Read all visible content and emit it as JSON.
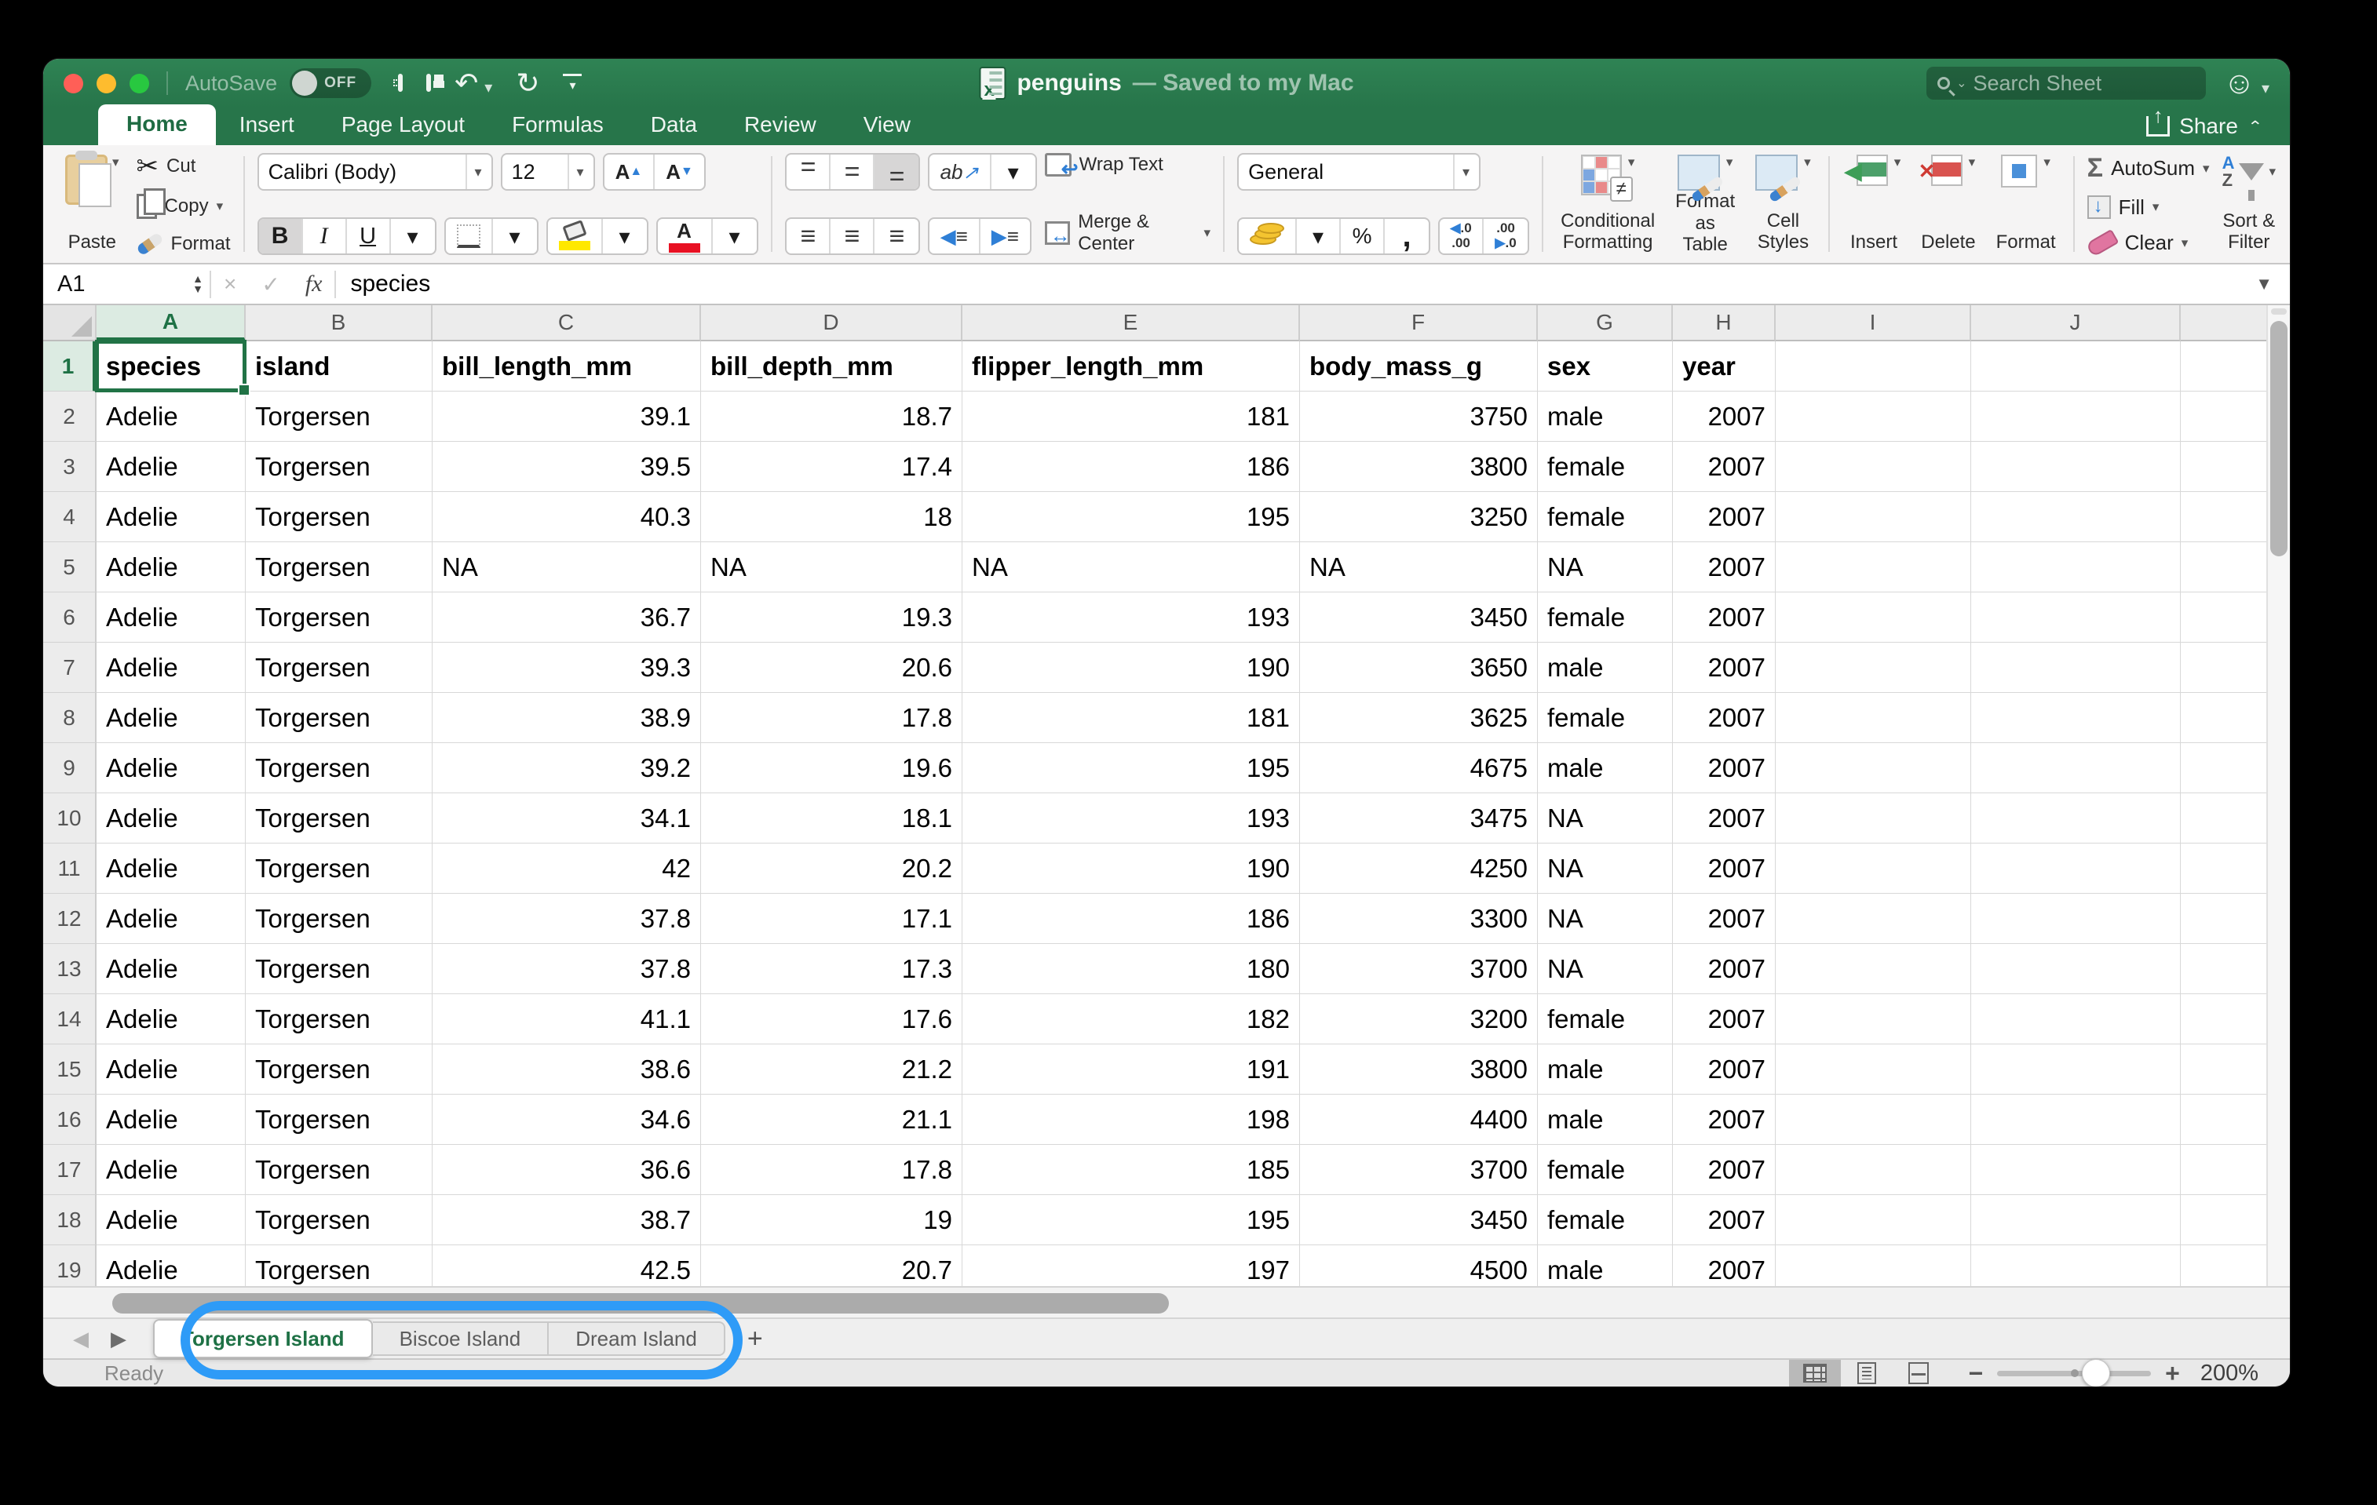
{
  "titlebar": {
    "autosave_label": "AutoSave",
    "autosave_state": "OFF",
    "file_name": "penguins",
    "file_status": "— Saved to my Mac",
    "search_placeholder": "Search Sheet"
  },
  "ribbon_tabs": [
    {
      "label": "Home",
      "active": true
    },
    {
      "label": "Insert",
      "active": false
    },
    {
      "label": "Page Layout",
      "active": false
    },
    {
      "label": "Formulas",
      "active": false
    },
    {
      "label": "Data",
      "active": false
    },
    {
      "label": "Review",
      "active": false
    },
    {
      "label": "View",
      "active": false
    }
  ],
  "share_label": "Share",
  "ribbon": {
    "clipboard": {
      "paste": "Paste",
      "cut": "Cut",
      "copy": "Copy",
      "format": "Format",
      "scissors_glyph": "✂"
    },
    "font": {
      "name": "Calibri (Body)",
      "size": "12",
      "bold": "B",
      "italic": "I",
      "underline": "U",
      "grow": "A",
      "shrink": "A",
      "color_letter": "A"
    },
    "alignment": {
      "lines_glyph": "≡",
      "orientation": "ab"
    },
    "wrap": {
      "wrap_text": "Wrap Text",
      "merge_center": "Merge & Center"
    },
    "number": {
      "format": "General",
      "percent": "%",
      "comma": ",",
      "inc_top": ".0",
      "inc_bot": ".00",
      "dec_top": ".00",
      "dec_bot": ".0"
    },
    "styles": {
      "cond_line1": "Conditional",
      "cond_line2": "Formatting",
      "neq": "≠",
      "fat_line1": "Format",
      "fat_line2": "as Table",
      "cs_line1": "Cell",
      "cs_line2": "Styles"
    },
    "cells": {
      "insert": "Insert",
      "delete": "Delete",
      "format": "Format",
      "ins_arrow": "◀",
      "del_x": "✕"
    },
    "editing": {
      "autosum_glyph": "Σ",
      "autosum": "AutoSum",
      "fill": "Fill",
      "clear": "Clear",
      "sort_line1": "Sort &",
      "sort_line2": "Filter",
      "az_a": "A",
      "az_z": "Z"
    }
  },
  "formula_bar": {
    "name_box": "A1",
    "cancel": "×",
    "enter": "✓",
    "fx": "fx",
    "value": "species"
  },
  "grid": {
    "column_letters": [
      "A",
      "B",
      "C",
      "D",
      "E",
      "F",
      "G",
      "H",
      "I",
      "J"
    ],
    "selected": {
      "cell": "A1",
      "column": "A",
      "row": 1
    },
    "header_row": [
      "species",
      "island",
      "bill_length_mm",
      "bill_depth_mm",
      "flipper_length_mm",
      "body_mass_g",
      "sex",
      "year"
    ],
    "rows": [
      [
        "Adelie",
        "Torgersen",
        "39.1",
        "18.7",
        "181",
        "3750",
        "male",
        "2007"
      ],
      [
        "Adelie",
        "Torgersen",
        "39.5",
        "17.4",
        "186",
        "3800",
        "female",
        "2007"
      ],
      [
        "Adelie",
        "Torgersen",
        "40.3",
        "18",
        "195",
        "3250",
        "female",
        "2007"
      ],
      [
        "Adelie",
        "Torgersen",
        "NA",
        "NA",
        "NA",
        "NA",
        "NA",
        "2007"
      ],
      [
        "Adelie",
        "Torgersen",
        "36.7",
        "19.3",
        "193",
        "3450",
        "female",
        "2007"
      ],
      [
        "Adelie",
        "Torgersen",
        "39.3",
        "20.6",
        "190",
        "3650",
        "male",
        "2007"
      ],
      [
        "Adelie",
        "Torgersen",
        "38.9",
        "17.8",
        "181",
        "3625",
        "female",
        "2007"
      ],
      [
        "Adelie",
        "Torgersen",
        "39.2",
        "19.6",
        "195",
        "4675",
        "male",
        "2007"
      ],
      [
        "Adelie",
        "Torgersen",
        "34.1",
        "18.1",
        "193",
        "3475",
        "NA",
        "2007"
      ],
      [
        "Adelie",
        "Torgersen",
        "42",
        "20.2",
        "190",
        "4250",
        "NA",
        "2007"
      ],
      [
        "Adelie",
        "Torgersen",
        "37.8",
        "17.1",
        "186",
        "3300",
        "NA",
        "2007"
      ],
      [
        "Adelie",
        "Torgersen",
        "37.8",
        "17.3",
        "180",
        "3700",
        "NA",
        "2007"
      ],
      [
        "Adelie",
        "Torgersen",
        "41.1",
        "17.6",
        "182",
        "3200",
        "female",
        "2007"
      ],
      [
        "Adelie",
        "Torgersen",
        "38.6",
        "21.2",
        "191",
        "3800",
        "male",
        "2007"
      ],
      [
        "Adelie",
        "Torgersen",
        "34.6",
        "21.1",
        "198",
        "4400",
        "male",
        "2007"
      ],
      [
        "Adelie",
        "Torgersen",
        "36.6",
        "17.8",
        "185",
        "3700",
        "female",
        "2007"
      ],
      [
        "Adelie",
        "Torgersen",
        "38.7",
        "19",
        "195",
        "3450",
        "female",
        "2007"
      ],
      [
        "Adelie",
        "Torgersen",
        "42.5",
        "20.7",
        "197",
        "4500",
        "male",
        "2007"
      ]
    ]
  },
  "sheet_tabs": {
    "tabs": [
      {
        "label": "Torgersen Island",
        "active": true
      },
      {
        "label": "Biscoe Island",
        "active": false
      },
      {
        "label": "Dream Island",
        "active": false
      }
    ],
    "add_label": "+"
  },
  "status_bar": {
    "ready": "Ready",
    "zoom": "200%",
    "minus": "−",
    "plus": "+"
  }
}
